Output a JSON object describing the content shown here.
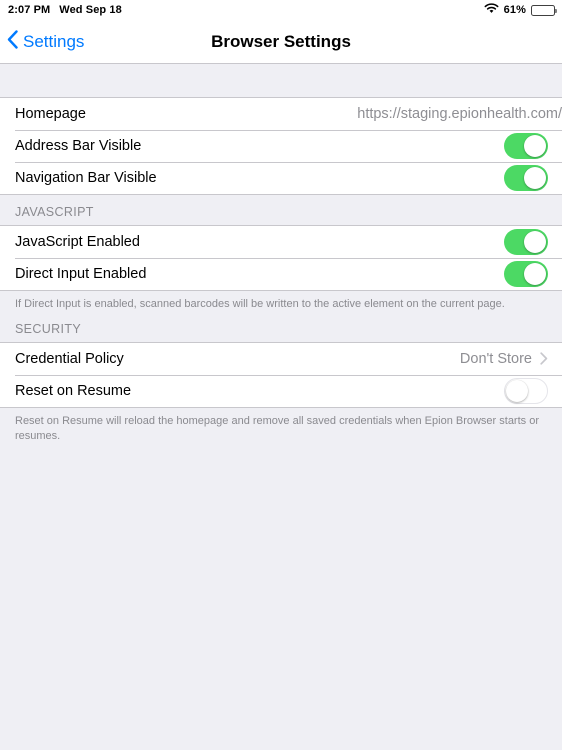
{
  "status_bar": {
    "time": "2:07 PM",
    "date": "Wed Sep 18",
    "wifi_icon": "wifi-icon",
    "battery_percent": "61%",
    "battery_level": 61
  },
  "nav_bar": {
    "back_label": "Settings",
    "back_icon": "chevron-left-icon",
    "title": "Browser Settings"
  },
  "sections": [
    {
      "header": "",
      "rows": [
        {
          "label": "Homepage",
          "type": "value",
          "value": "https://staging.epionhealth.com/"
        },
        {
          "label": "Address Bar Visible",
          "type": "toggle",
          "state": "on"
        },
        {
          "label": "Navigation Bar Visible",
          "type": "toggle",
          "state": "on"
        }
      ],
      "footer": ""
    },
    {
      "header": "JAVASCRIPT",
      "rows": [
        {
          "label": "JavaScript Enabled",
          "type": "toggle",
          "state": "on"
        },
        {
          "label": "Direct Input Enabled",
          "type": "toggle",
          "state": "on"
        }
      ],
      "footer": "If Direct Input is enabled, scanned barcodes will be written to the active element on the current page."
    },
    {
      "header": "SECURITY",
      "rows": [
        {
          "label": "Credential Policy",
          "type": "disclosure",
          "value": "Don't Store"
        },
        {
          "label": "Reset on Resume",
          "type": "toggle",
          "state": "off"
        }
      ],
      "footer": "Reset on Resume will reload the homepage and remove all saved credentials when Epion Browser starts or resumes."
    }
  ],
  "colors": {
    "accent": "#007AFF",
    "toggle_on": "#4CD964",
    "background": "#EFEFF4",
    "separator": "#C8C7CC",
    "secondary_text": "#8E8E93"
  }
}
